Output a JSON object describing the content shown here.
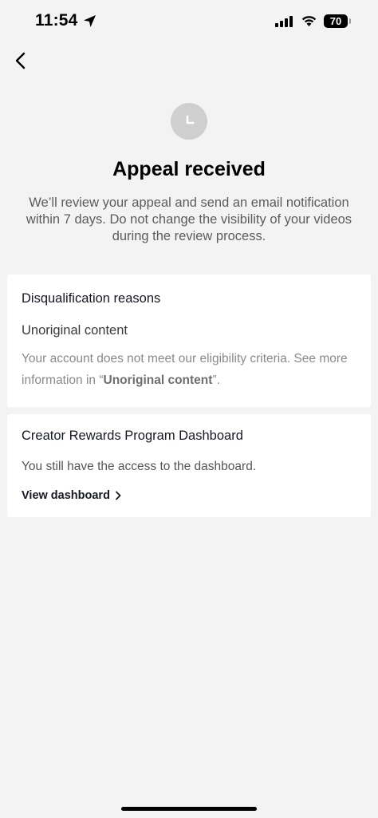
{
  "status_bar": {
    "time": "11:54",
    "battery": "70",
    "location_icon": "location-arrow-icon",
    "signal_icon": "cellular-signal-icon",
    "wifi_icon": "wifi-icon"
  },
  "header": {
    "back_icon": "chevron-left-icon"
  },
  "hero": {
    "icon": "clock-icon",
    "title": "Appeal received",
    "description": "We’ll review your appeal and send an email notification within 7 days. Do not change the visibility of your videos during the review process."
  },
  "disqualification": {
    "title": "Disqualification reasons",
    "reason_name": "Unoriginal content",
    "desc_prefix": "Your account does not meet our eligibility criteria. See more information in “",
    "desc_link": "Unoriginal content",
    "desc_suffix": "”."
  },
  "dashboard": {
    "title": "Creator Rewards Program Dashboard",
    "description": "You still have the access to the dashboard.",
    "link_label": "View dashboard",
    "link_icon": "chevron-right-icon"
  },
  "colors": {
    "background": "#f3f3f3",
    "card": "#ffffff",
    "icon_circle": "#cfcfcf"
  }
}
